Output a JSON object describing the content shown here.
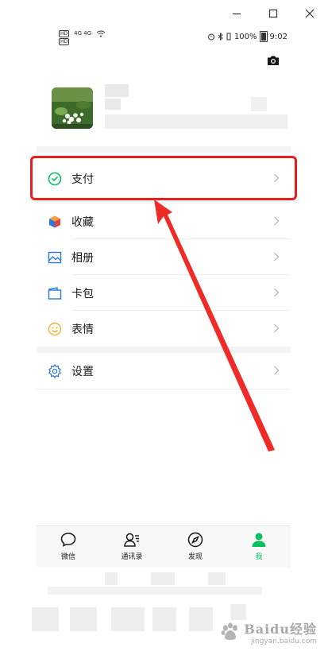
{
  "window": {
    "controls": [
      "minimize",
      "maximize",
      "close"
    ]
  },
  "status_bar": {
    "left_badges": [
      "HD",
      "HD"
    ],
    "left_network": "4G 4G",
    "battery": "100%",
    "time": "9:02"
  },
  "menu": {
    "items": [
      {
        "label": "支付",
        "icon": "wechat-pay-icon",
        "color": "#07c160"
      },
      {
        "label": "收藏",
        "icon": "favorites-cube-icon",
        "color": "#fa9d3b"
      },
      {
        "label": "相册",
        "icon": "album-icon",
        "color": "#2b7bd6"
      },
      {
        "label": "卡包",
        "icon": "card-wallet-icon",
        "color": "#2b7bd6"
      },
      {
        "label": "表情",
        "icon": "sticker-smile-icon",
        "color": "#f2b12f"
      },
      {
        "label": "设置",
        "icon": "settings-gear-icon",
        "color": "#2b7bd6"
      }
    ]
  },
  "tabbar": {
    "tabs": [
      {
        "label": "微信",
        "icon": "chat-bubble-icon",
        "active": false
      },
      {
        "label": "通讯录",
        "icon": "contacts-icon",
        "active": false
      },
      {
        "label": "发现",
        "icon": "compass-icon",
        "active": false
      },
      {
        "label": "我",
        "icon": "me-person-icon",
        "active": true
      }
    ]
  },
  "watermark": {
    "main": "Baidu经验",
    "sub": "jingyan.baidu.com"
  },
  "colors": {
    "wechat_green": "#07c160",
    "annotation_red": "#e5201e"
  }
}
